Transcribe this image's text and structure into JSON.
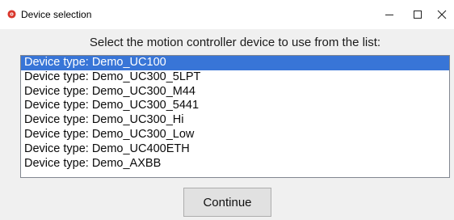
{
  "window": {
    "title": "Device selection",
    "controls": {
      "minimize": "–",
      "maximize": "□",
      "close": "×"
    },
    "icon": "red-gear-icon"
  },
  "prompt": "Select the motion controller device to use from the list:",
  "device_list": {
    "selected_index": 0,
    "items": [
      "Device type: Demo_UC100",
      "Device type: Demo_UC300_5LPT",
      "Device type: Demo_UC300_M44",
      "Device type: Demo_UC300_5441",
      "Device type: Demo_UC300_Hi",
      "Device type: Demo_UC300_Low",
      "Device type: Demo_UC400ETH",
      "Device type: Demo_AXBB"
    ]
  },
  "continue_label": "Continue",
  "colors": {
    "selection": "#3875d7",
    "background": "#f0f0f0",
    "icon": "#d9372c"
  }
}
